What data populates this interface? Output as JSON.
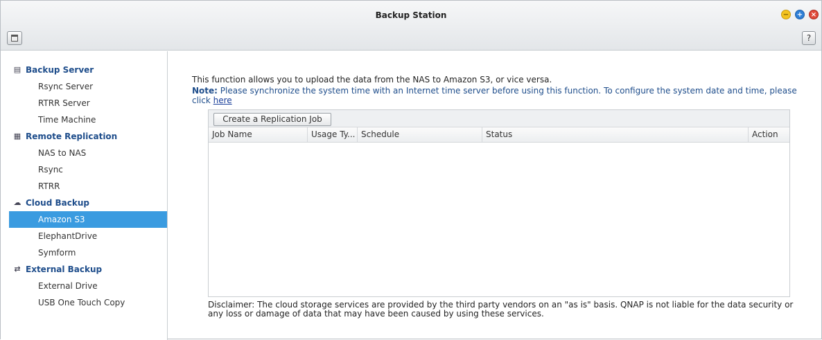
{
  "window": {
    "title": "Backup Station",
    "controls": {
      "minimize": "−",
      "maximize": "+",
      "close": "×"
    },
    "help_label": "?"
  },
  "sidebar": {
    "sections": [
      {
        "label": "Backup Server",
        "icon": "server-icon",
        "items": [
          "Rsync Server",
          "RTRR Server",
          "Time Machine"
        ]
      },
      {
        "label": "Remote Replication",
        "icon": "replication-icon",
        "items": [
          "NAS to NAS",
          "Rsync",
          "RTRR"
        ]
      },
      {
        "label": "Cloud Backup",
        "icon": "cloud-icon",
        "items": [
          "Amazon S3",
          "ElephantDrive",
          "Symform"
        ]
      },
      {
        "label": "External Backup",
        "icon": "sync-icon",
        "items": [
          "External Drive",
          "USB One Touch Copy"
        ]
      }
    ],
    "selected": "Amazon S3",
    "selected_color": "#3a9be0"
  },
  "main": {
    "intro": "This function allows you to upload the data from the NAS to Amazon S3, or vice versa.",
    "note_label": "Note:",
    "note_text": " Please synchronize the system time with an Internet time server before using this function. To configure the system date and time, please click ",
    "note_link": "here",
    "create_button": "Create a Replication Job",
    "columns": [
      "Job Name",
      "Usage Ty...",
      "Schedule",
      "Status",
      "Action"
    ],
    "rows": [],
    "disclaimer": "Disclaimer: The cloud storage services are provided by the third party vendors on an \"as is\" basis. QNAP is not liable for the data security or any loss or damage of data that may have been caused by using these services."
  }
}
